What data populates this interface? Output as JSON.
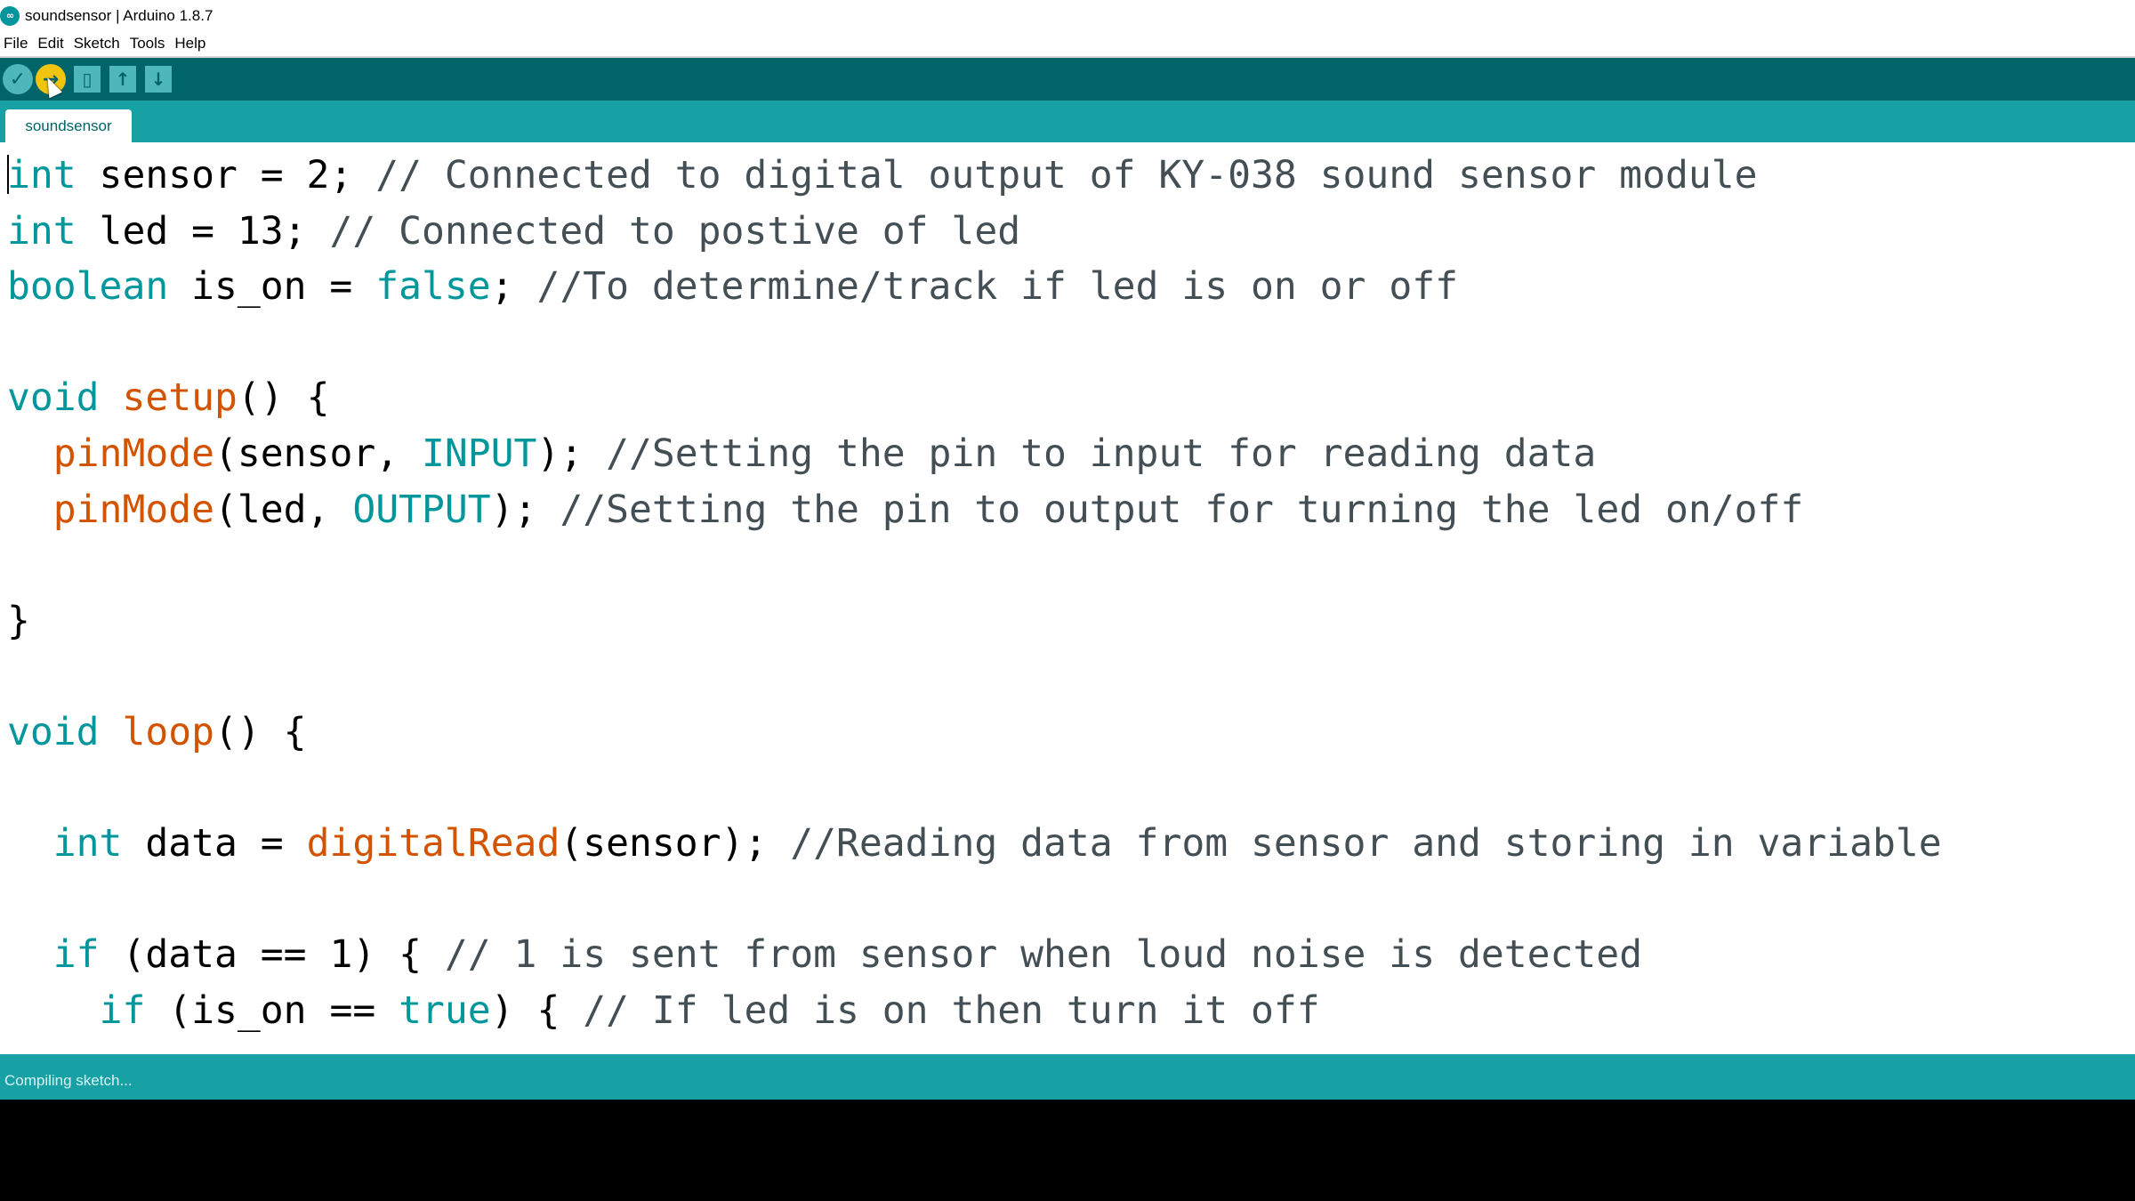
{
  "window": {
    "title": "soundsensor | Arduino 1.8.7",
    "logo_label": "∞"
  },
  "menu": {
    "items": [
      "File",
      "Edit",
      "Sketch",
      "Tools",
      "Help"
    ]
  },
  "toolbar": {
    "buttons": [
      {
        "name": "verify",
        "icon": "checkmark-icon",
        "glyph": "✓"
      },
      {
        "name": "upload",
        "icon": "right-arrow-icon",
        "glyph": "→",
        "active": true
      },
      {
        "name": "new",
        "icon": "new-file-icon",
        "glyph": "▯"
      },
      {
        "name": "open",
        "icon": "up-arrow-icon",
        "glyph": "↑"
      },
      {
        "name": "save",
        "icon": "down-arrow-icon",
        "glyph": "↓"
      }
    ]
  },
  "tabs": [
    {
      "label": "soundsensor",
      "active": true
    }
  ],
  "editor": {
    "lines": [
      [
        {
          "t": "int",
          "c": "kw"
        },
        {
          "t": " sensor = 2; ",
          "c": ""
        },
        {
          "t": "// Connected to digital output of KY-038 sound sensor module",
          "c": "cm"
        }
      ],
      [
        {
          "t": "int",
          "c": "kw"
        },
        {
          "t": " led = 13; ",
          "c": ""
        },
        {
          "t": "// Connected to postive of led",
          "c": "cm"
        }
      ],
      [
        {
          "t": "boolean",
          "c": "kw"
        },
        {
          "t": " is_on = ",
          "c": ""
        },
        {
          "t": "false",
          "c": "kw"
        },
        {
          "t": "; ",
          "c": ""
        },
        {
          "t": "//To determine/track if led is on or off",
          "c": "cm"
        }
      ],
      [],
      [
        {
          "t": "void",
          "c": "kw"
        },
        {
          "t": " ",
          "c": ""
        },
        {
          "t": "setup",
          "c": "fn"
        },
        {
          "t": "() {",
          "c": ""
        }
      ],
      [
        {
          "t": "  ",
          "c": ""
        },
        {
          "t": "pinMode",
          "c": "fn"
        },
        {
          "t": "(sensor, ",
          "c": ""
        },
        {
          "t": "INPUT",
          "c": "kw"
        },
        {
          "t": "); ",
          "c": ""
        },
        {
          "t": "//Setting the pin to input for reading data",
          "c": "cm"
        }
      ],
      [
        {
          "t": "  ",
          "c": ""
        },
        {
          "t": "pinMode",
          "c": "fn"
        },
        {
          "t": "(led, ",
          "c": ""
        },
        {
          "t": "OUTPUT",
          "c": "kw"
        },
        {
          "t": "); ",
          "c": ""
        },
        {
          "t": "//Setting the pin to output for turning the led on/off",
          "c": "cm"
        }
      ],
      [],
      [
        {
          "t": "}",
          "c": ""
        }
      ],
      [],
      [
        {
          "t": "void",
          "c": "kw"
        },
        {
          "t": " ",
          "c": ""
        },
        {
          "t": "loop",
          "c": "fn"
        },
        {
          "t": "() {",
          "c": ""
        }
      ],
      [],
      [
        {
          "t": "  ",
          "c": ""
        },
        {
          "t": "int",
          "c": "kw"
        },
        {
          "t": " data = ",
          "c": ""
        },
        {
          "t": "digitalRead",
          "c": "fn"
        },
        {
          "t": "(sensor); ",
          "c": ""
        },
        {
          "t": "//Reading data from sensor and storing in variable",
          "c": "cm"
        }
      ],
      [],
      [
        {
          "t": "  ",
          "c": ""
        },
        {
          "t": "if",
          "c": "kw"
        },
        {
          "t": " (data == 1) { ",
          "c": ""
        },
        {
          "t": "// 1 is sent from sensor when loud noise is detected",
          "c": "cm"
        }
      ],
      [
        {
          "t": "    ",
          "c": ""
        },
        {
          "t": "if",
          "c": "kw"
        },
        {
          "t": " (is_on == ",
          "c": ""
        },
        {
          "t": "true",
          "c": "kw"
        },
        {
          "t": ") { ",
          "c": ""
        },
        {
          "t": "// If led is on then turn it off",
          "c": "cm"
        }
      ]
    ]
  },
  "status": {
    "text": "Compiling sketch..."
  },
  "colors": {
    "toolbar": "#006468",
    "tabbar": "#17a1a5",
    "keyword": "#00979c",
    "function": "#d35400",
    "comment": "#434f54",
    "upload_active": "#f1c40f"
  }
}
